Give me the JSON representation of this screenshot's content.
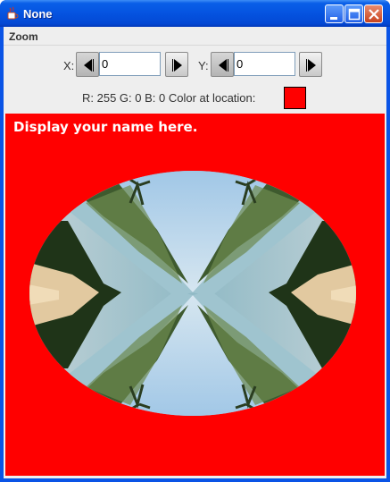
{
  "window": {
    "title": "None",
    "icons": {
      "app": "java-cup-icon",
      "minimize": "minimize-icon",
      "maximize": "maximize-icon",
      "close": "close-icon"
    }
  },
  "menubar": {
    "items": [
      {
        "label": "Zoom"
      }
    ]
  },
  "controls": {
    "x_label": "X:",
    "x_value": "0",
    "y_label": "Y:",
    "y_value": "0",
    "prev_icon": "arrow-left-icon",
    "next_icon": "arrow-right-icon"
  },
  "color_info": {
    "text": "R: 255 G: 0 B: 0 Color at location:",
    "swatch_color": "#ff0000"
  },
  "canvas": {
    "caption": "Display your name here.",
    "background_color": "#ff0000",
    "content": "mirrored-landscape-photo-in-oval"
  }
}
